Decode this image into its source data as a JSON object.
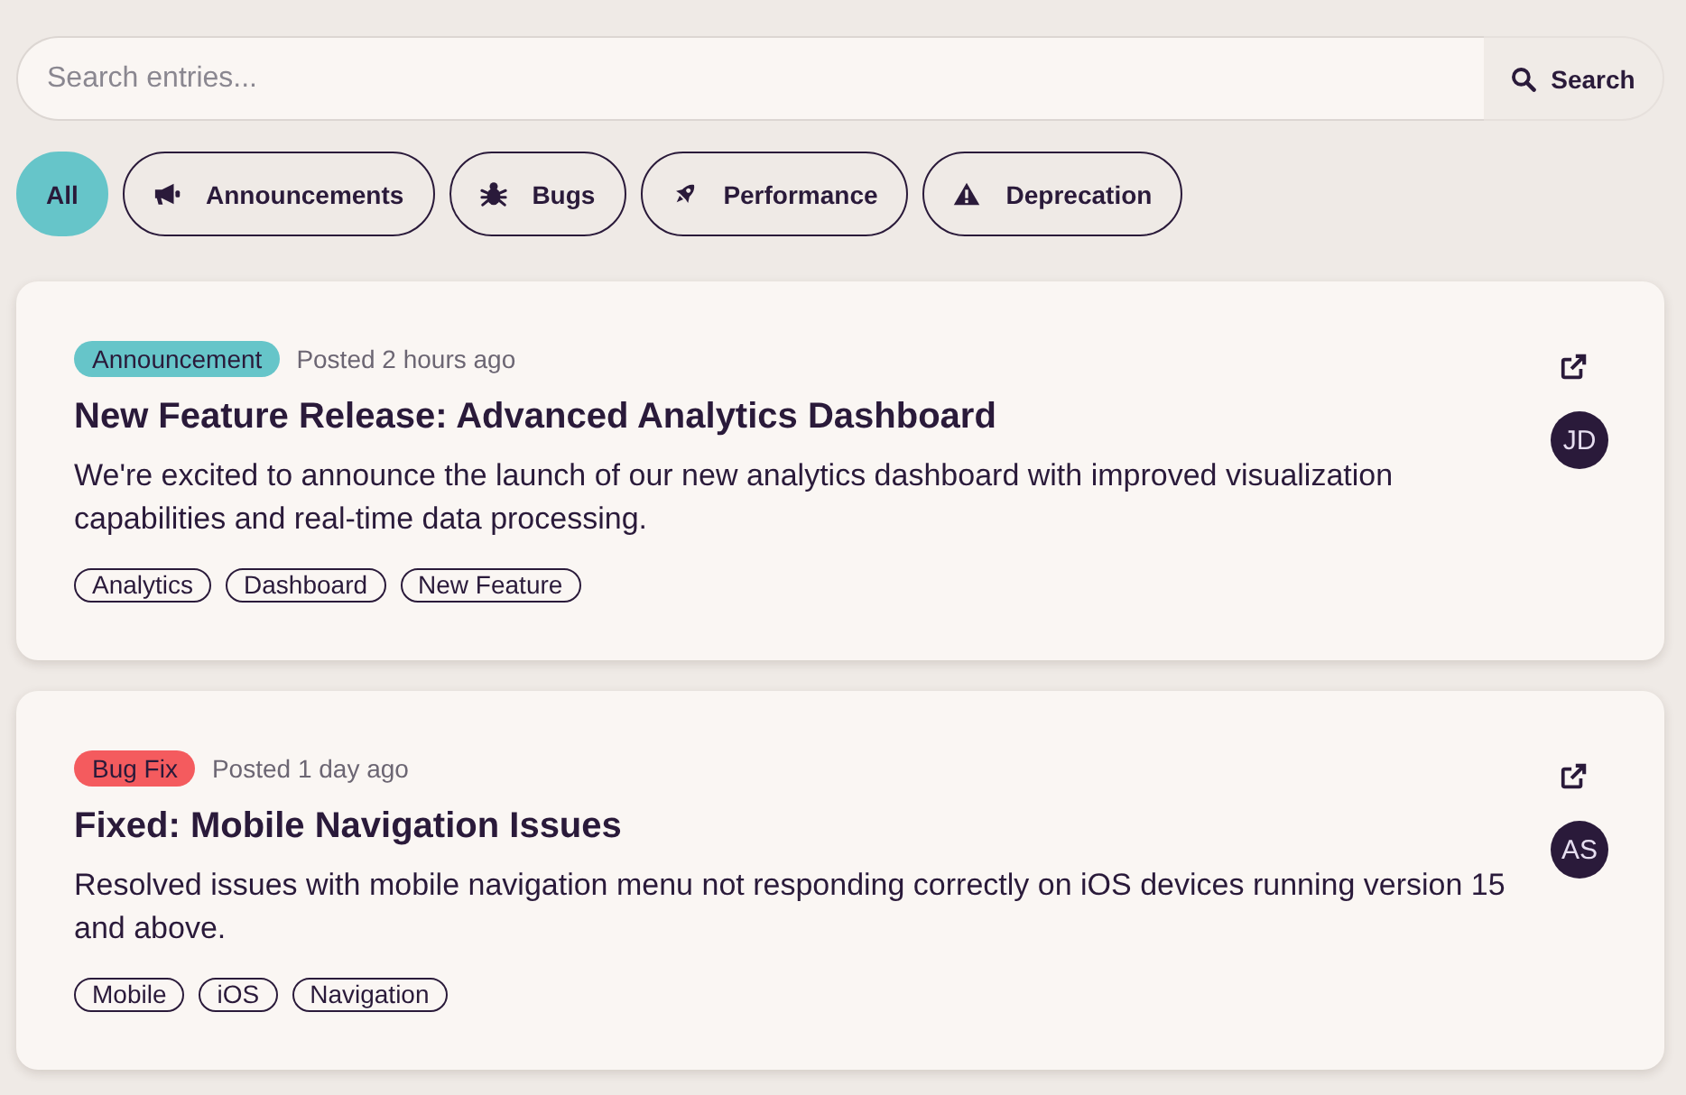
{
  "search": {
    "placeholder": "Search entries...",
    "button": "Search"
  },
  "filters": [
    {
      "label": "All",
      "kind": "all",
      "selected": true
    },
    {
      "label": "Announcements",
      "kind": "announcement",
      "selected": false
    },
    {
      "label": "Bugs",
      "kind": "bug",
      "selected": false
    },
    {
      "label": "Performance",
      "kind": "performance",
      "selected": false
    },
    {
      "label": "Deprecation",
      "kind": "deprecation",
      "selected": false
    }
  ],
  "entries": [
    {
      "category": {
        "label": "Announcement",
        "color": "#66c5c9"
      },
      "posted": "Posted 2 hours ago",
      "title": "New Feature Release: Advanced Analytics Dashboard",
      "description": "We're excited to announce the launch of our new analytics dashboard with improved visualization capabilities and real-time data processing.",
      "tags": [
        "Analytics",
        "Dashboard",
        "New Feature"
      ],
      "author": "JD"
    },
    {
      "category": {
        "label": "Bug Fix",
        "color": "#f45b5e"
      },
      "posted": "Posted 1 day ago",
      "title": "Fixed: Mobile Navigation Issues",
      "description": "Resolved issues with mobile navigation menu not responding correctly on iOS devices running version 15 and above.",
      "tags": [
        "Mobile",
        "iOS",
        "Navigation"
      ],
      "author": "AS"
    }
  ]
}
